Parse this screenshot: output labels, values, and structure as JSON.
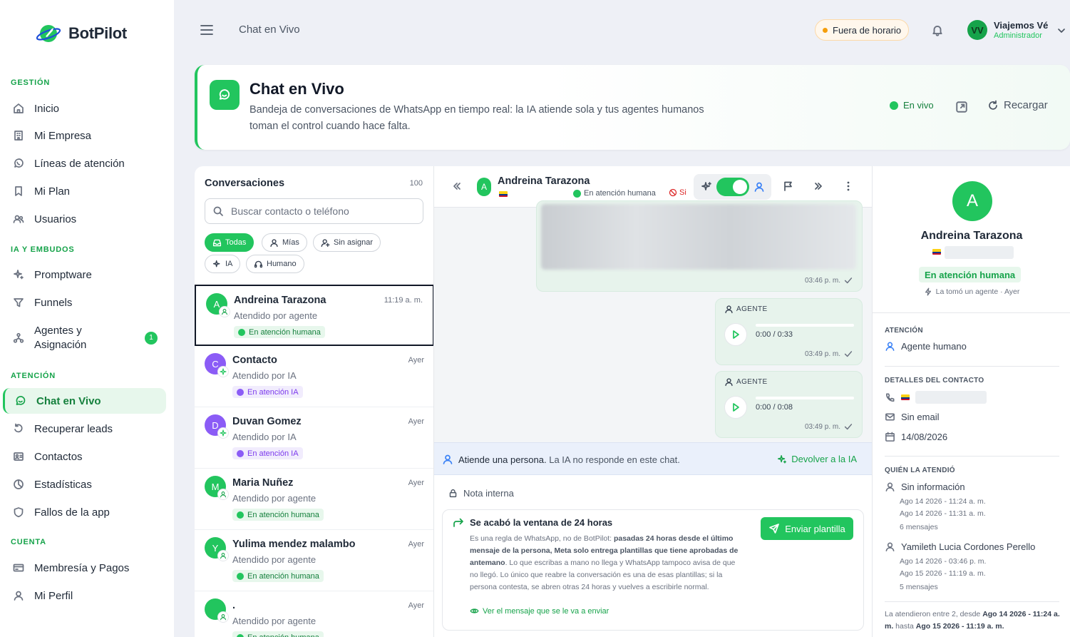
{
  "brand": {
    "name": "BotPilot"
  },
  "sidebar": {
    "sections": [
      {
        "label": "GESTIÓN"
      },
      {
        "label": "IA Y EMBUDOS"
      },
      {
        "label": "ATENCIÓN"
      },
      {
        "label": "CUENTA"
      }
    ],
    "items": [
      {
        "label": "Inicio",
        "icon": "home-icon"
      },
      {
        "label": "Mi Empresa",
        "icon": "building-icon"
      },
      {
        "label": "Líneas de atención",
        "icon": "whatsapp-icon"
      },
      {
        "label": "Mi Plan",
        "icon": "bookmark-icon"
      },
      {
        "label": "Usuarios",
        "icon": "users-icon"
      },
      {
        "label": "Promptware",
        "icon": "sparkle-icon"
      },
      {
        "label": "Funnels",
        "icon": "funnel-icon"
      },
      {
        "label": "Agentes y",
        "label2": "Asignación",
        "icon": "network-icon",
        "badge": "1"
      },
      {
        "label": "Chat en Vivo",
        "icon": "chat-icon",
        "active": true
      },
      {
        "label": "Recuperar leads",
        "icon": "undo-icon"
      },
      {
        "label": "Contactos",
        "icon": "contacts-icon"
      },
      {
        "label": "Estadísticas",
        "icon": "pie-icon"
      },
      {
        "label": "Fallos de la app",
        "icon": "shield-icon"
      },
      {
        "label": "Membresía y Pagos",
        "icon": "card-icon"
      },
      {
        "label": "Mi Perfil",
        "icon": "user-icon"
      }
    ]
  },
  "topbar": {
    "title": "Chat en Vivo",
    "status": "Fuera de horario",
    "user": {
      "initials": "VV",
      "name": "Viajemos Vé",
      "role": "Administrador"
    }
  },
  "hero": {
    "title": "Chat en Vivo",
    "subtitle": "Bandeja de conversaciones de WhatsApp en tiempo real: la IA atiende sola y tus agentes humanos toman el control cuando hace falta.",
    "live": "En vivo",
    "reload": "Recargar"
  },
  "conversations": {
    "title": "Conversaciones",
    "count": "100",
    "search_placeholder": "Buscar contacto o teléfono",
    "filters": [
      "Todas",
      "Mías",
      "Sin asignar",
      "IA",
      "Humano"
    ],
    "items": [
      {
        "initial": "A",
        "name": "Andreina Tarazona",
        "time": "11:19 a. m.",
        "sub": "Atendido por agente",
        "tag": "En atención humana",
        "kind": "human",
        "color": "#22c55e",
        "selected": true
      },
      {
        "initial": "C",
        "name": "Contacto",
        "time": "Ayer",
        "sub": "Atendido por IA",
        "tag": "En atención IA",
        "kind": "ia",
        "color": "#8b5cf6"
      },
      {
        "initial": "D",
        "name": "Duvan Gomez",
        "time": "Ayer",
        "sub": "Atendido por IA",
        "tag": "En atención IA",
        "kind": "ia",
        "color": "#8b5cf6"
      },
      {
        "initial": "M",
        "name": "Maria Nuñez",
        "time": "Ayer",
        "sub": "Atendido por agente",
        "tag": "En atención humana",
        "kind": "human",
        "color": "#22c55e"
      },
      {
        "initial": "Y",
        "name": "Yulima mendez malambo",
        "time": "Ayer",
        "sub": "Atendido por agente",
        "tag": "En atención humana",
        "kind": "human",
        "color": "#22c55e"
      },
      {
        "initial": "",
        "name": ".",
        "time": "Ayer",
        "sub": "Atendido por agente",
        "tag": "En atención humana",
        "kind": "human",
        "color": "#22c55e"
      }
    ]
  },
  "chat": {
    "initial": "A",
    "name": "Andreina Tarazona",
    "state": "En atención humana",
    "no_label": "Si",
    "messages": [
      {
        "time": "03:46 p. m."
      },
      {
        "label": "AGENTE",
        "duration": "0:00 / 0:33",
        "time": "03:49 p. m."
      },
      {
        "label": "AGENTE",
        "duration": "0:00 / 0:08",
        "time": "03:49 p. m."
      }
    ],
    "banner": {
      "strong": "Atiende una persona.",
      "rest": " La IA no responde en este chat.",
      "action": "Devolver a la IA"
    },
    "note_label": "Nota interna",
    "window": {
      "title": "Se acabó la ventana de 24 horas",
      "t1": "Es una regla de WhatsApp, no de BotPilot: ",
      "t2": "pasadas 24 horas desde el último mensaje de la persona, Meta solo entrega plantillas que tiene aprobadas de antemano",
      "t3": ". Lo que escribas a mano no llega y WhatsApp tampoco avisa de que no llegó. Lo único que reabre la conversación es una de esas plantillas; si la persona contesta, se abren otras 24 horas y vuelves a escribirle normal.",
      "link": "Ver el mensaje que se le va a enviar",
      "button": "Enviar plantilla"
    }
  },
  "contact": {
    "initial": "A",
    "name": "Andreina Tarazona",
    "state": "En atención humana",
    "took": "La tomó un agente · Ayer",
    "atencion_title": "ATENCIÓN",
    "atencion_value": "Agente humano",
    "details_title": "DETALLES DEL CONTACTO",
    "email": "Sin email",
    "date": "14/08/2026",
    "who_title": "QUIÉN LA ATENDIÓ",
    "who": [
      {
        "name": "Sin información",
        "l1": "Ago 14 2026 - 11:24 a. m.",
        "l2": "Ago 14 2026 - 11:31 a. m.",
        "l3": "6 mensajes"
      },
      {
        "name": "Yamileth Lucia Cordones Perello",
        "l1": "Ago 14 2026 - 03:46 p. m.",
        "l2": "Ago 15 2026 - 11:19 a. m.",
        "l3": "5 mensajes"
      }
    ],
    "footer": {
      "a": "La atendieron entre 2, desde ",
      "b": "Ago 14 2026 - 11:24 a. m.",
      "c": " hasta ",
      "d": "Ago 15 2026 - 11:19 a. m."
    }
  }
}
